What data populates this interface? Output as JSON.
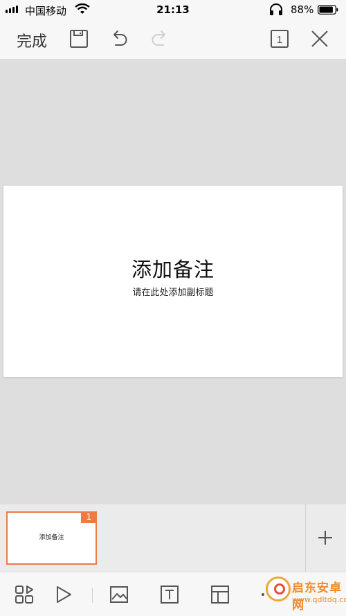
{
  "status_bar": {
    "carrier": "中国移动",
    "time": "21:13",
    "battery_percent": "88%",
    "battery_level": 0.88
  },
  "toolbar": {
    "done_label": "完成",
    "slide_count": "1",
    "icons": [
      "save-icon",
      "undo-icon",
      "redo-icon",
      "slide-count-icon",
      "close-icon"
    ]
  },
  "slide": {
    "title": "添加备注",
    "subtitle": "请在此处添加副标题"
  },
  "thumbnails": [
    {
      "number": "1",
      "title": "添加备注",
      "selected": true
    }
  ],
  "bottom_bar": {
    "icons": [
      "slides-grid-icon",
      "play-icon",
      "image-icon",
      "text-box-icon",
      "layout-icon",
      "more-icon"
    ]
  },
  "watermark": {
    "name": "启东安卓网",
    "url": "www.qdltdq.com"
  },
  "colors": {
    "accent": "#ee7a45",
    "canvas_bg": "#dedede",
    "toolbar_bg": "#f7f7f7"
  }
}
